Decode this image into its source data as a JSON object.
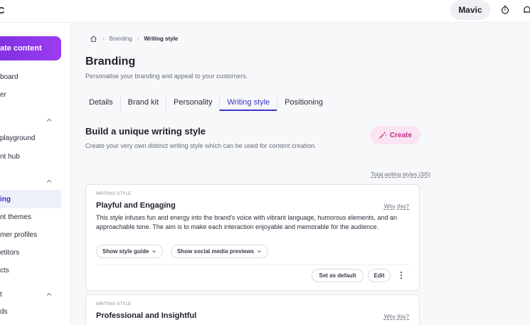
{
  "topbar": {
    "logo": "C",
    "user_name": "Mavic"
  },
  "sidebar": {
    "create_label": "ate content",
    "items": [
      {
        "label": "board"
      },
      {
        "label": "er"
      },
      {
        "label": "playground"
      },
      {
        "label": "nt hub"
      },
      {
        "label": "ing"
      },
      {
        "label": "nt themes"
      },
      {
        "label": "mer profiles"
      },
      {
        "label": "etitors"
      },
      {
        "label": "cts"
      },
      {
        "label": "t"
      },
      {
        "label": "ds"
      }
    ]
  },
  "breadcrumb": {
    "items": [
      "Branding",
      "Writing style"
    ]
  },
  "page": {
    "title": "Branding",
    "subtitle": "Personalise your branding and appeal to your customers."
  },
  "tabs": [
    {
      "label": "Details"
    },
    {
      "label": "Brand kit"
    },
    {
      "label": "Personality"
    },
    {
      "label": "Writing style"
    },
    {
      "label": "Positioning"
    }
  ],
  "section": {
    "title": "Build a unique writing style",
    "subtitle": "Create your very own distinct writing style which can be used for content creation.",
    "create_label": "Create",
    "total_label": "Total writing styles (3/5)"
  },
  "cards": [
    {
      "eyebrow": "WRITING STYLE",
      "title": "Playful and Engaging",
      "why": "Why this?",
      "description": "This style infuses fun and energy into the brand's voice with vibrant language, humorous elements, and an approachable tone. The aim is to make each interaction enjoyable and memorable for the audience.",
      "chip_guide": "Show style guide",
      "chip_social": "Show social media previews",
      "default_label": "Set as default",
      "edit_label": "Edit"
    },
    {
      "eyebrow": "WRITING STYLE",
      "title": "Professional and Insightful",
      "why": "Why this?"
    }
  ],
  "colors": {
    "accent": "#3b35c5",
    "create_gradient_start": "#7a2fe0",
    "create_pill_bg": "#fbe4f2",
    "create_pill_text": "#c42f8e"
  }
}
